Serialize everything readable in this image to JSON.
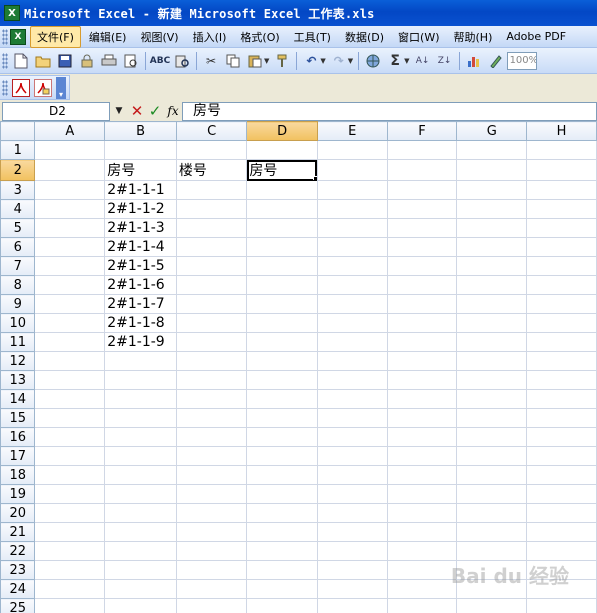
{
  "window": {
    "title": "Microsoft Excel - 新建 Microsoft Excel 工作表.xls"
  },
  "menu": {
    "items": [
      {
        "label": "文件(F)",
        "active": true
      },
      {
        "label": "编辑(E)"
      },
      {
        "label": "视图(V)"
      },
      {
        "label": "插入(I)"
      },
      {
        "label": "格式(O)"
      },
      {
        "label": "工具(T)"
      },
      {
        "label": "数据(D)"
      },
      {
        "label": "窗口(W)"
      },
      {
        "label": "帮助(H)"
      },
      {
        "label": "Adobe PDF"
      }
    ]
  },
  "toolbar": {
    "zoom": "100%",
    "icons": [
      "new-icon",
      "open-icon",
      "save-icon",
      "permission-icon",
      "print-icon",
      "print-preview-icon",
      "spelling-icon",
      "research-icon",
      "cut-icon",
      "copy-icon",
      "paste-icon",
      "format-painter-icon",
      "undo-icon",
      "redo-icon",
      "hyperlink-icon",
      "autosum-icon",
      "sort-ascending-icon",
      "sort-descending-icon",
      "chart-wizard-icon",
      "drawing-icon"
    ]
  },
  "pdf_toolbar": {
    "icons": [
      "convert-to-pdf-icon",
      "convert-and-email-icon"
    ]
  },
  "formula_bar": {
    "name_box": "D2",
    "fx": "fx",
    "content": "房号"
  },
  "grid": {
    "columns": [
      "A",
      "B",
      "C",
      "D",
      "E",
      "F",
      "G",
      "H"
    ],
    "selected_column": "D",
    "selected_row": 2,
    "active_cell": "D2",
    "row_count": 25,
    "cells": {
      "B2": "房号",
      "C2": "楼号",
      "D2": "房号",
      "B3": "2#1-1-1",
      "B4": "2#1-1-2",
      "B5": "2#1-1-3",
      "B6": "2#1-1-4",
      "B7": "2#1-1-5",
      "B8": "2#1-1-6",
      "B9": "2#1-1-7",
      "B10": "2#1-1-8",
      "B11": "2#1-1-9"
    }
  },
  "watermark": "Bai du 经验"
}
